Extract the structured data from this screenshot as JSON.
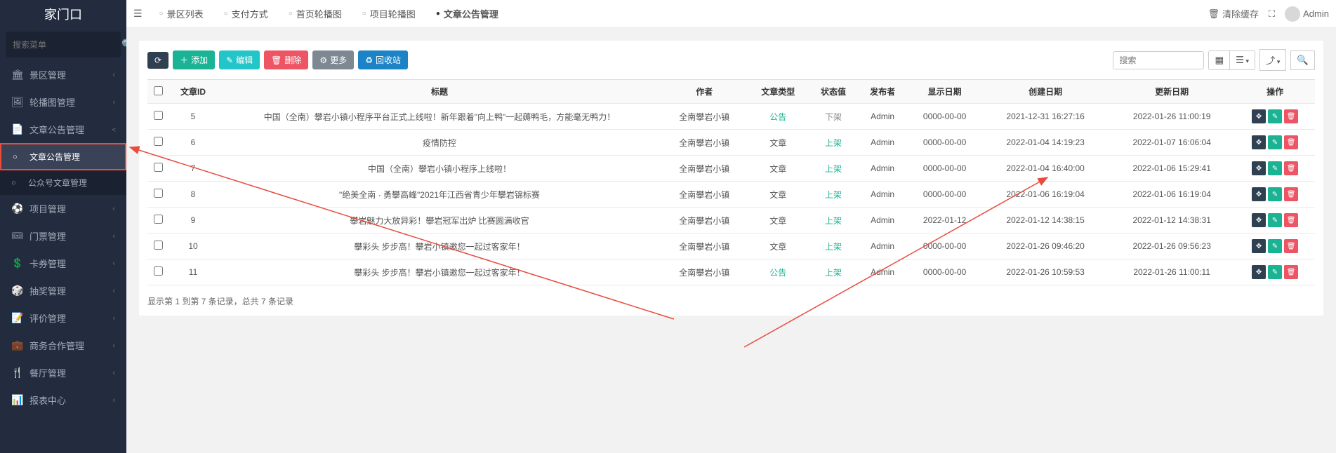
{
  "brand": "家门口",
  "sidebar_search_placeholder": "搜索菜单",
  "sidebar_items": [
    {
      "icon": "🏛",
      "label": "景区管理",
      "sub": []
    },
    {
      "icon": "🖼",
      "label": "轮播图管理",
      "sub": []
    },
    {
      "icon": "📄",
      "label": "文章公告管理",
      "expanded": true,
      "sub": [
        {
          "label": "文章公告管理",
          "active": true
        },
        {
          "label": "公众号文章管理"
        }
      ]
    },
    {
      "icon": "⚽",
      "label": "项目管理",
      "sub": []
    },
    {
      "icon": "🎟",
      "label": "门票管理",
      "sub": []
    },
    {
      "icon": "💲",
      "label": "卡券管理",
      "sub": []
    },
    {
      "icon": "🎲",
      "label": "抽奖管理",
      "sub": []
    },
    {
      "icon": "📝",
      "label": "评价管理",
      "sub": []
    },
    {
      "icon": "💼",
      "label": "商务合作管理",
      "sub": []
    },
    {
      "icon": "🍴",
      "label": "餐厅管理",
      "sub": []
    },
    {
      "icon": "📊",
      "label": "报表中心",
      "sub": []
    }
  ],
  "tabs": [
    {
      "label": "景区列表"
    },
    {
      "label": "支付方式"
    },
    {
      "label": "首页轮播图"
    },
    {
      "label": "项目轮播图"
    },
    {
      "label": "文章公告管理",
      "active": true
    }
  ],
  "topbar": {
    "clear_cache": "清除缓存",
    "user": "Admin"
  },
  "toolbar": {
    "refresh_icon": "⟳",
    "add": "添加",
    "edit": "编辑",
    "delete": "删除",
    "more": "更多",
    "recycle": "回收站",
    "search_placeholder": "搜索"
  },
  "columns": [
    "",
    "文章ID",
    "标题",
    "作者",
    "文章类型",
    "状态值",
    "发布者",
    "显示日期",
    "创建日期",
    "更新日期",
    "操作"
  ],
  "rows": [
    {
      "id": "5",
      "title": "中国（全南）攀岩小镇小程序平台正式上线啦！新年跟着\"向上鸭\"一起薅鸭毛，方能毫无鸭力！",
      "author": "全南攀岩小镇",
      "type": "公告",
      "type_class": "green",
      "status": "下架",
      "status_class": "gray",
      "publisher": "Admin",
      "show_date": "0000-00-00",
      "created": "2021-12-31 16:27:16",
      "updated": "2022-01-26 11:00:19"
    },
    {
      "id": "6",
      "title": "疫情防控",
      "author": "全南攀岩小镇",
      "type": "文章",
      "type_class": "",
      "status": "上架",
      "status_class": "green",
      "publisher": "Admin",
      "show_date": "0000-00-00",
      "created": "2022-01-04 14:19:23",
      "updated": "2022-01-07 16:06:04"
    },
    {
      "id": "7",
      "title": "中国（全南）攀岩小镇小程序上线啦！",
      "author": "全南攀岩小镇",
      "type": "文章",
      "type_class": "",
      "status": "上架",
      "status_class": "green",
      "publisher": "Admin",
      "show_date": "0000-00-00",
      "created": "2022-01-04 16:40:00",
      "updated": "2022-01-06 15:29:41"
    },
    {
      "id": "8",
      "title": "\"绝美全南 · 勇攀高峰\"2021年江西省青少年攀岩锦标赛",
      "author": "全南攀岩小镇",
      "type": "文章",
      "type_class": "",
      "status": "上架",
      "status_class": "green",
      "publisher": "Admin",
      "show_date": "0000-00-00",
      "created": "2022-01-06 16:19:04",
      "updated": "2022-01-06 16:19:04"
    },
    {
      "id": "9",
      "title": "攀岩魅力大放异彩！攀岩冠军出炉 比赛圆满收官",
      "author": "全南攀岩小镇",
      "type": "文章",
      "type_class": "",
      "status": "上架",
      "status_class": "green",
      "publisher": "Admin",
      "show_date": "2022-01-12",
      "created": "2022-01-12 14:38:15",
      "updated": "2022-01-12 14:38:31"
    },
    {
      "id": "10",
      "title": "攀彩头 步步高！攀岩小镇邀您一起过客家年！",
      "author": "全南攀岩小镇",
      "type": "文章",
      "type_class": "",
      "status": "上架",
      "status_class": "green",
      "publisher": "Admin",
      "show_date": "0000-00-00",
      "created": "2022-01-26 09:46:20",
      "updated": "2022-01-26 09:56:23"
    },
    {
      "id": "11",
      "title": "攀彩头 步步高！攀岩小镇邀您一起过客家年！",
      "author": "全南攀岩小镇",
      "type": "公告",
      "type_class": "green",
      "status": "上架",
      "status_class": "green",
      "publisher": "Admin",
      "show_date": "0000-00-00",
      "created": "2022-01-26 10:59:53",
      "updated": "2022-01-26 11:00:11"
    }
  ],
  "pagination_info": "显示第 1 到第 7 条记录，总共 7 条记录"
}
